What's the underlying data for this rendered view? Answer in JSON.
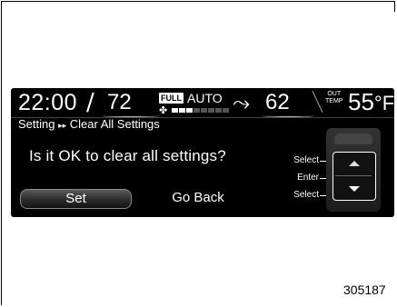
{
  "status_bar": {
    "time": "22:00",
    "left_temp": "72",
    "full_badge": "FULL",
    "mode": "AUTO",
    "fan_icon": "fan-icon",
    "fan_level": 0.375,
    "vent_icon": "airflow-vent-icon",
    "right_temp": "62",
    "out_label_line1": "OUT",
    "out_label_line2": "TEMP",
    "outside_temp": "55",
    "outside_unit": "°F"
  },
  "breadcrumb": {
    "parent": "Setting",
    "separator": "▸▸",
    "current": "Clear All Settings"
  },
  "dialog": {
    "question": "Is it OK to clear all settings?",
    "set_label": "Set",
    "goback_label": "Go Back"
  },
  "controls": {
    "select_top": "Select",
    "enter": "Enter",
    "select_bottom": "Select"
  },
  "figure_id": "305187",
  "colors": {
    "screen_bg": "#000000",
    "text": "#ffffff",
    "fan_bar_on": "#ffffff",
    "fan_bar_off": "#555555"
  }
}
